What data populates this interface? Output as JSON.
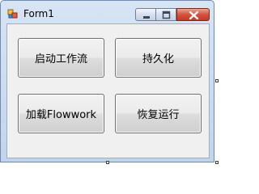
{
  "window": {
    "title": "Form1",
    "icon": "form-icon",
    "controls": {
      "minimize": "minimize-icon",
      "maximize": "maximize-icon",
      "close": "close-icon"
    }
  },
  "buttons": {
    "start_workflow": "启动工作流",
    "persist": "持久化",
    "load_flowwork": "加载Flowwork",
    "resume": "恢复运行"
  },
  "colors": {
    "close_button": "#c43a25",
    "titlebar": "#c3d4ea",
    "client_background": "#f0f0f0"
  }
}
